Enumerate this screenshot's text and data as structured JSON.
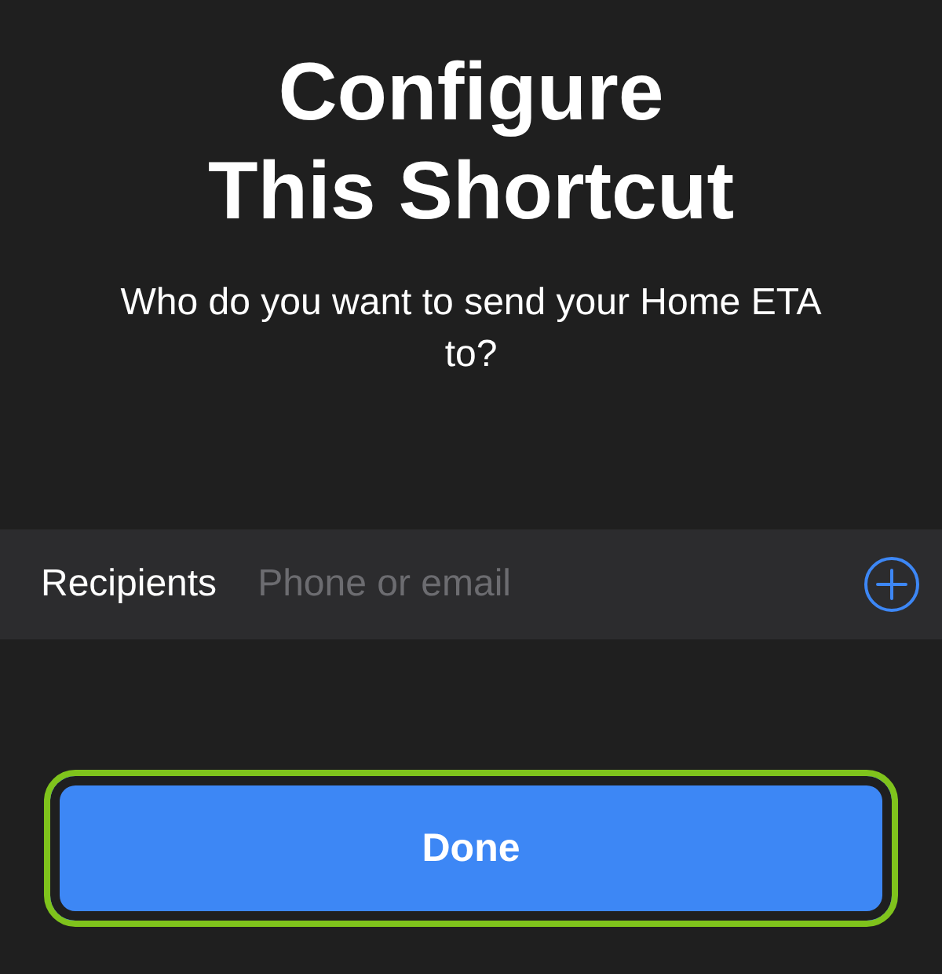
{
  "title": "Configure This Shortcut",
  "prompt": "Who do you want to send your Home ETA to?",
  "recipients_field": {
    "label": "Recipients",
    "placeholder": "Phone or email"
  },
  "done_button": {
    "label": "Done",
    "highlighted": true
  }
}
